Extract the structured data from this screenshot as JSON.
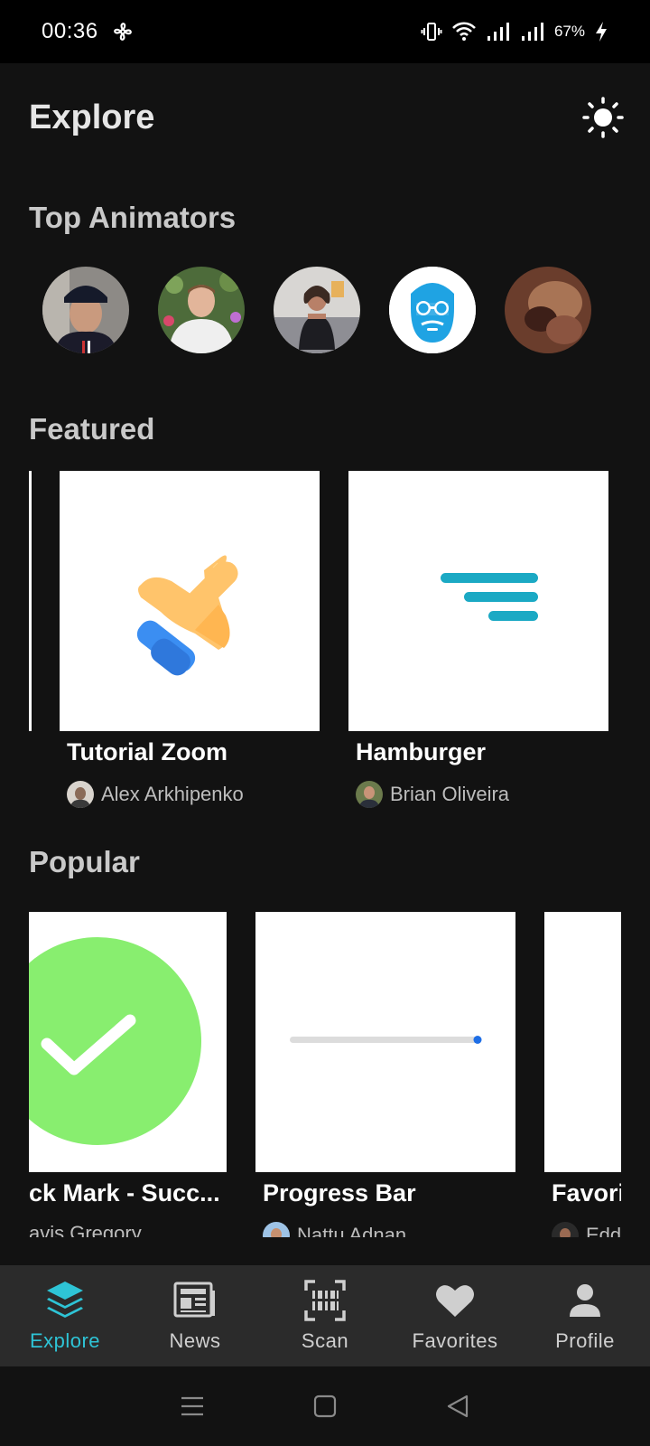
{
  "status_bar": {
    "time": "00:36",
    "battery_percent": "67%",
    "icons": [
      "fan-icon",
      "vibrate-icon",
      "wifi-icon",
      "signal-icon",
      "signal-icon",
      "charging-icon"
    ]
  },
  "header": {
    "title": "Explore",
    "theme_icon": "sun-icon"
  },
  "top_animators": {
    "title": "Top Animators"
  },
  "featured": {
    "title": "Featured",
    "items": [
      {
        "title": "Tutorial Zoom",
        "author": "Alex Arkhipenko"
      },
      {
        "title": "Hamburger",
        "author": "Brian Oliveira"
      }
    ]
  },
  "popular": {
    "title": "Popular",
    "items": [
      {
        "title": "ck Mark - Succ...",
        "author": "avis Gregory"
      },
      {
        "title": "Progress Bar",
        "author": "Nattu Adnan"
      },
      {
        "title": "Favori",
        "author": "Edd"
      }
    ]
  },
  "bottom_nav": {
    "items": [
      {
        "label": "Explore",
        "icon": "layers-icon",
        "active": true
      },
      {
        "label": "News",
        "icon": "newspaper-icon"
      },
      {
        "label": "Scan",
        "icon": "scan-icon"
      },
      {
        "label": "Favorites",
        "icon": "heart-icon"
      },
      {
        "label": "Profile",
        "icon": "person-icon"
      }
    ]
  },
  "colors": {
    "background": "#121212",
    "accent": "#2ec4d6",
    "nav_background": "#2b2b2b"
  }
}
